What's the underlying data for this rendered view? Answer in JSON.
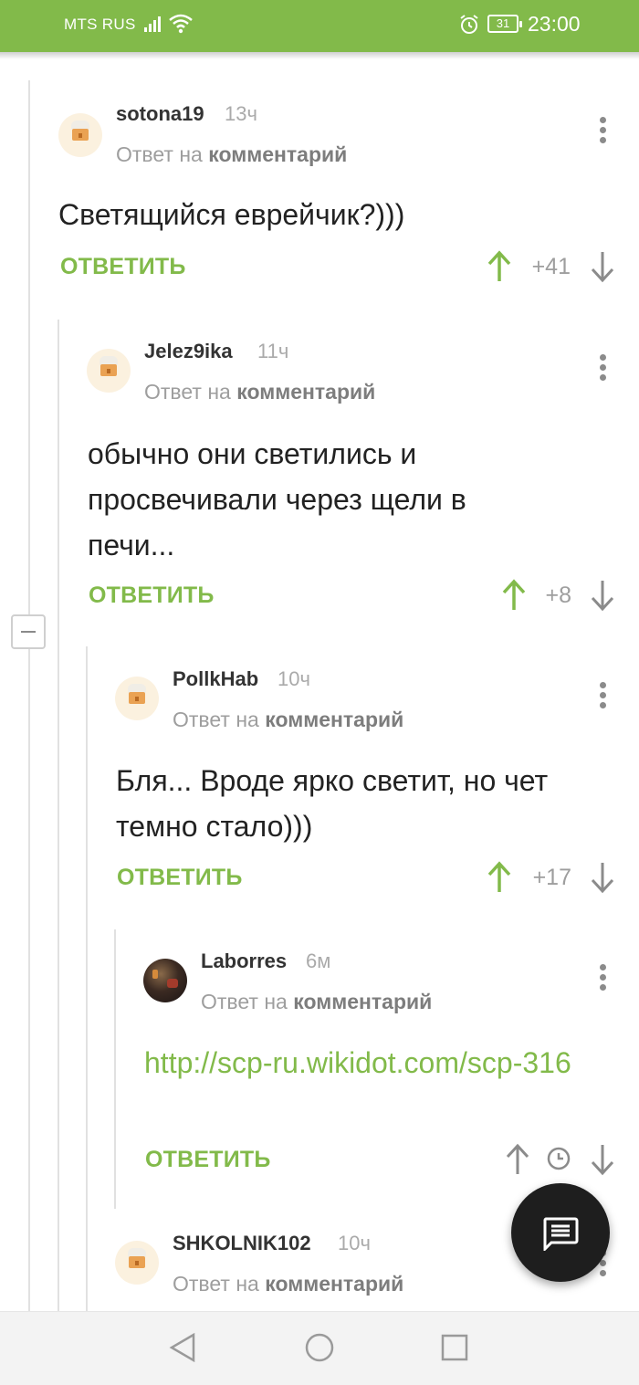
{
  "status_bar": {
    "carrier": "MTS RUS",
    "battery": "31",
    "time": "23:00"
  },
  "reply_label": "ОТВЕТИТЬ",
  "reply_to_prefix": "Ответ на",
  "reply_to_link": "комментарий",
  "comments": [
    {
      "username": "sotona19",
      "time": "13ч",
      "text": "Светящийся еврейчик?)))",
      "votes": "+41"
    },
    {
      "username": "Jelez9ika",
      "time": "11ч",
      "text": "обычно они светились и просвечивали через щели в печи...",
      "votes": "+8"
    },
    {
      "username": "PollkHab",
      "time": "10ч",
      "text": "Бля... Вроде ярко светит, но чет темно стало)))",
      "votes": "+17"
    },
    {
      "username": "Laborres",
      "time": "6м",
      "text": "http://scp-ru.wikidot.com/scp-316",
      "votes": ""
    },
    {
      "username": "SHKOLNIK102",
      "time": "10ч",
      "text": "",
      "votes": ""
    }
  ],
  "icons": {
    "signal": "signal-bars-icon",
    "wifi": "wifi-icon",
    "alarm": "alarm-clock-icon",
    "more": "more-vertical-icon",
    "upvote": "arrow-up-icon",
    "downvote": "arrow-down-icon",
    "pending_score": "clock-icon",
    "fab": "message-icon",
    "nav_back": "back-triangle-icon",
    "nav_home": "home-circle-icon",
    "nav_recents": "recents-square-icon"
  },
  "colors": {
    "accent": "#82ba4a",
    "status_bar": "#82ba4a",
    "fab": "#1e1e1e",
    "meta_text": "#9e9e9e"
  }
}
